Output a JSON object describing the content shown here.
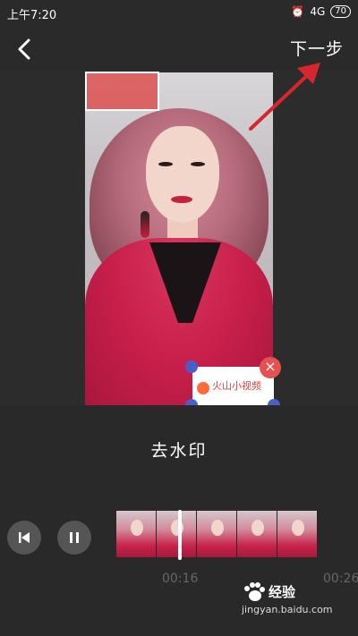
{
  "status": {
    "time": "上午7:20",
    "network": "4G",
    "battery": "70"
  },
  "header": {
    "next_label": "下一步"
  },
  "preview": {
    "watermark_text": "火山小视频"
  },
  "panel": {
    "title": "去水印",
    "time_current": "00:16",
    "time_end": "00:26"
  },
  "branding": {
    "name": "经验",
    "url": "jingyan.baidu.com"
  },
  "colors": {
    "arrow": "#d6262e",
    "handle": "#4b5ec8",
    "close": "#e65050"
  },
  "icons": [
    "back-icon",
    "alarm-icon",
    "battery-icon",
    "close-icon",
    "skip-back-icon",
    "pause-icon"
  ]
}
